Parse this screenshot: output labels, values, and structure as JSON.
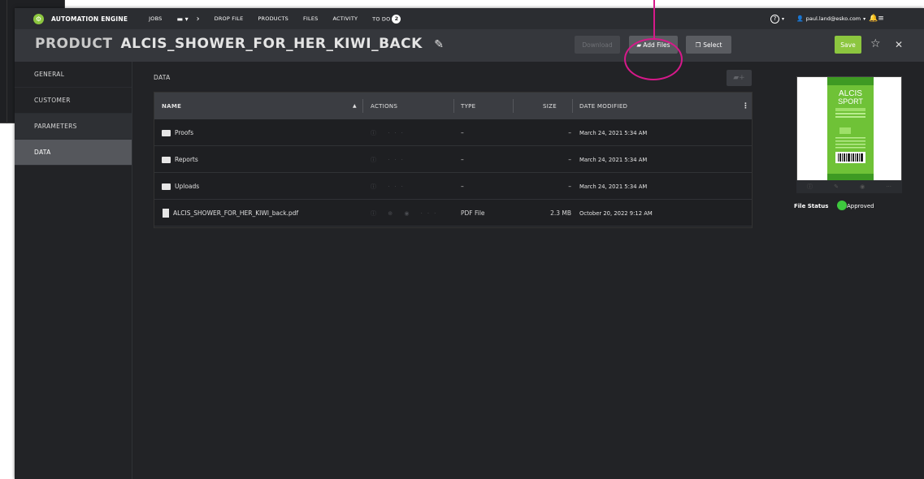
{
  "nav": {
    "brand": "AUTOMATION ENGINE",
    "items": [
      "JOBS",
      "DROP FILE",
      "PRODUCTS",
      "FILES",
      "ACTIVITY",
      "TO DO"
    ],
    "todo_count": "2",
    "user": "paul.land@esko.com"
  },
  "header": {
    "label": "PRODUCT",
    "name": "ALCIS_SHOWER_FOR_HER_KIWI_BACK",
    "download": "Download",
    "add_files": "Add Files",
    "select": "Select",
    "save": "Save"
  },
  "sidebar": {
    "items": [
      "GENERAL",
      "CUSTOMER",
      "PARAMETERS",
      "DATA"
    ],
    "active": "DATA"
  },
  "data": {
    "label": "DATA",
    "columns": [
      "NAME",
      "ACTIONS",
      "TYPE",
      "SIZE",
      "DATE MODIFIED"
    ],
    "rows": [
      {
        "name": "Proofs",
        "type": "–",
        "size": "–",
        "date": "March 24, 2021 5:34 AM",
        "kind": "folder"
      },
      {
        "name": "Reports",
        "type": "–",
        "size": "–",
        "date": "March 24, 2021 5:34 AM",
        "kind": "folder"
      },
      {
        "name": "Uploads",
        "type": "–",
        "size": "–",
        "date": "March 24, 2021 5:34 AM",
        "kind": "folder"
      },
      {
        "name": "ALCIS_SHOWER_FOR_HER_KIWI_back.pdf",
        "type": "PDF File",
        "size": "2.3 MB",
        "date": "October 20, 2022 9:12 AM",
        "kind": "pdf"
      }
    ]
  },
  "preview": {
    "brand_top": "ALCIS",
    "brand_bottom": "SPORT",
    "status_label": "File Status",
    "status_value": "Approved",
    "status_color": "#3ec83e"
  },
  "colors": {
    "accent": "#8cc63f",
    "highlight": "#d6198a"
  }
}
